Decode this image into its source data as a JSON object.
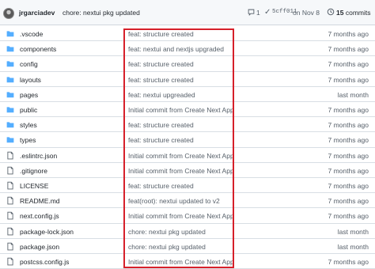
{
  "commit": {
    "author": "jrgarciadev",
    "message": "chore: nextui pkg updated",
    "comments": "1",
    "sha": "5cff011",
    "date": "on Nov 8",
    "commits_count": "15",
    "commits_label": "commits"
  },
  "files": [
    {
      "type": "folder",
      "name": ".vscode",
      "message": "feat: structure created",
      "age": "7 months ago"
    },
    {
      "type": "folder",
      "name": "components",
      "message": "feat: nextui and nextjs upgraded",
      "age": "7 months ago"
    },
    {
      "type": "folder",
      "name": "config",
      "message": "feat: structure created",
      "age": "7 months ago"
    },
    {
      "type": "folder",
      "name": "layouts",
      "message": "feat: structure created",
      "age": "7 months ago"
    },
    {
      "type": "folder",
      "name": "pages",
      "message": "feat: nextui upgreaded",
      "age": "last month"
    },
    {
      "type": "folder",
      "name": "public",
      "message": "Initial commit from Create Next App",
      "age": "7 months ago"
    },
    {
      "type": "folder",
      "name": "styles",
      "message": "feat: structure created",
      "age": "7 months ago"
    },
    {
      "type": "folder",
      "name": "types",
      "message": "feat: structure created",
      "age": "7 months ago"
    },
    {
      "type": "file",
      "name": ".eslintrc.json",
      "message": "Initial commit from Create Next App",
      "age": "7 months ago"
    },
    {
      "type": "file",
      "name": ".gitignore",
      "message": "Initial commit from Create Next App",
      "age": "7 months ago"
    },
    {
      "type": "file",
      "name": "LICENSE",
      "message": "feat: structure created",
      "age": "7 months ago"
    },
    {
      "type": "file",
      "name": "README.md",
      "message": "feat(root): nextui updated to v2",
      "age": "7 months ago"
    },
    {
      "type": "file",
      "name": "next.config.js",
      "message": "Initial commit from Create Next App",
      "age": "7 months ago"
    },
    {
      "type": "file",
      "name": "package-lock.json",
      "message": "chore: nextui pkg updated",
      "age": "last month"
    },
    {
      "type": "file",
      "name": "package.json",
      "message": "chore: nextui pkg updated",
      "age": "last month"
    },
    {
      "type": "file",
      "name": "postcss.config.js",
      "message": "Initial commit from Create Next App",
      "age": "7 months ago"
    }
  ],
  "colors": {
    "folder": "#54aeff",
    "file": "#57606a",
    "highlight": "#d6202a"
  }
}
